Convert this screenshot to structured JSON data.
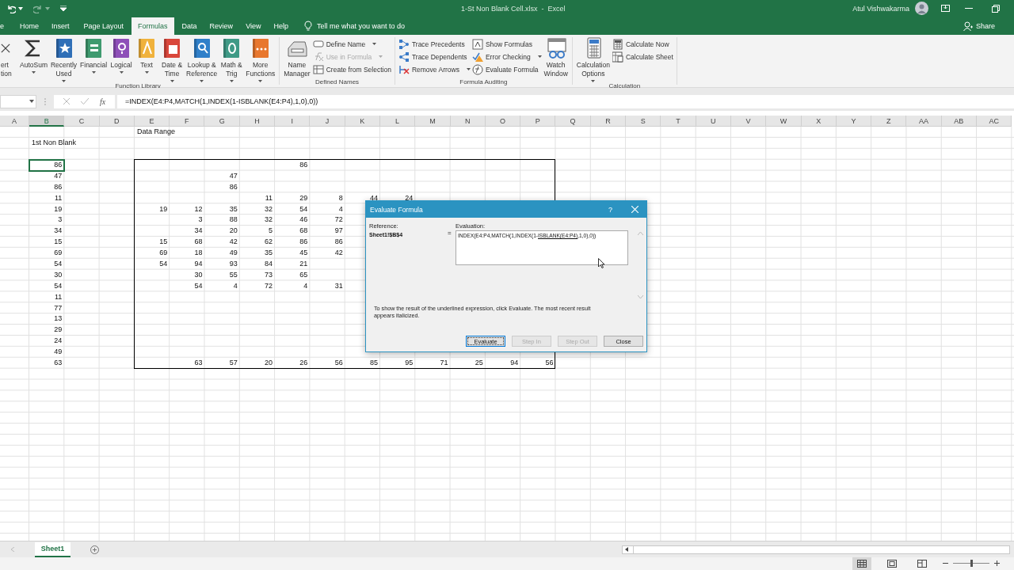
{
  "title_bar": {
    "document_title": "1-St Non Blank Cell.xlsx  -  Excel",
    "user_name": "Atul Vishwakarma"
  },
  "tabs": [
    {
      "label": "e",
      "selected": false
    },
    {
      "label": "Home",
      "selected": false
    },
    {
      "label": "Insert",
      "selected": false
    },
    {
      "label": "Page Layout",
      "selected": false
    },
    {
      "label": "Formulas",
      "selected": true
    },
    {
      "label": "Data",
      "selected": false
    },
    {
      "label": "Review",
      "selected": false
    },
    {
      "label": "View",
      "selected": false
    },
    {
      "label": "Help",
      "selected": false
    }
  ],
  "tell_me": "Tell me what you want to do",
  "share": "Share",
  "ribbon": {
    "groups": [
      {
        "label": "Function Library",
        "stacks": [
          [
            {
              "kind": "large",
              "lines": [
                "ert",
                "tion"
              ],
              "dropdown": false,
              "disabled": false
            }
          ],
          [
            {
              "kind": "large",
              "lines": [
                "AutoSum"
              ],
              "dropdown": true,
              "disabled": false
            }
          ],
          [
            {
              "kind": "large",
              "lines": [
                "Recently",
                "Used"
              ],
              "dropdown": true,
              "disabled": false
            }
          ],
          [
            {
              "kind": "large",
              "lines": [
                "Financial"
              ],
              "dropdown": true,
              "disabled": false
            }
          ],
          [
            {
              "kind": "large",
              "lines": [
                "Logical"
              ],
              "dropdown": true,
              "disabled": false
            }
          ],
          [
            {
              "kind": "large",
              "lines": [
                "Text"
              ],
              "dropdown": true,
              "disabled": false
            }
          ],
          [
            {
              "kind": "large",
              "lines": [
                "Date &",
                "Time"
              ],
              "dropdown": true,
              "disabled": false
            }
          ],
          [
            {
              "kind": "large",
              "lines": [
                "Lookup &",
                "Reference"
              ],
              "dropdown": true,
              "disabled": false
            }
          ],
          [
            {
              "kind": "large",
              "lines": [
                "Math &",
                "Trig"
              ],
              "dropdown": true,
              "disabled": false
            }
          ],
          [
            {
              "kind": "large",
              "lines": [
                "More",
                "Functions"
              ],
              "dropdown": true,
              "disabled": false
            }
          ]
        ]
      },
      {
        "label": "Defined Names",
        "stacks": [
          [
            {
              "kind": "large",
              "lines": [
                "Name",
                "Manager"
              ],
              "dropdown": false,
              "disabled": false
            }
          ],
          [
            {
              "kind": "small",
              "lines": [
                "Define Name"
              ],
              "dropdown": true,
              "disabled": false
            },
            {
              "kind": "small",
              "lines": [
                "Use in Formula"
              ],
              "dropdown": true,
              "disabled": true
            },
            {
              "kind": "small",
              "lines": [
                "Create from Selection"
              ],
              "dropdown": false,
              "disabled": false
            }
          ]
        ]
      },
      {
        "label": "Formula Auditing",
        "stacks": [
          [
            {
              "kind": "small",
              "lines": [
                "Trace Precedents"
              ],
              "dropdown": false,
              "disabled": false
            },
            {
              "kind": "small",
              "lines": [
                "Trace Dependents"
              ],
              "dropdown": false,
              "disabled": false
            },
            {
              "kind": "small",
              "lines": [
                "Remove Arrows"
              ],
              "dropdown": true,
              "disabled": false
            }
          ],
          [
            {
              "kind": "small",
              "lines": [
                "Show Formulas"
              ],
              "dropdown": false,
              "disabled": false
            },
            {
              "kind": "small",
              "lines": [
                "Error Checking"
              ],
              "dropdown": true,
              "disabled": false
            },
            {
              "kind": "small",
              "lines": [
                "Evaluate Formula"
              ],
              "dropdown": false,
              "disabled": false
            }
          ],
          [
            {
              "kind": "large",
              "lines": [
                "Watch",
                "Window"
              ],
              "dropdown": false,
              "disabled": false
            }
          ]
        ]
      },
      {
        "label": "Calculation",
        "stacks": [
          [
            {
              "kind": "large",
              "lines": [
                "Calculation",
                "Options"
              ],
              "dropdown": true,
              "disabled": false
            }
          ],
          [
            {
              "kind": "small",
              "lines": [
                "Calculate Now"
              ],
              "dropdown": false,
              "disabled": false
            },
            {
              "kind": "small",
              "lines": [
                "Calculate Sheet"
              ],
              "dropdown": false,
              "disabled": false
            }
          ]
        ]
      }
    ]
  },
  "formula_bar": {
    "fx_label": "fx",
    "formula": "=INDEX(E4:P4,MATCH(1,INDEX(1-ISBLANK(E4:P4),1,0),0))"
  },
  "sheet": {
    "columns": [
      {
        "label": "A",
        "selected": false
      },
      {
        "label": "B",
        "selected": true
      },
      {
        "label": "C",
        "selected": false
      },
      {
        "label": "D",
        "selected": false
      },
      {
        "label": "E",
        "selected": false
      },
      {
        "label": "F",
        "selected": false
      },
      {
        "label": "G",
        "selected": false
      },
      {
        "label": "H",
        "selected": false
      },
      {
        "label": "I",
        "selected": false
      },
      {
        "label": "J",
        "selected": false
      },
      {
        "label": "K",
        "selected": false
      },
      {
        "label": "L",
        "selected": false
      },
      {
        "label": "M",
        "selected": false
      },
      {
        "label": "N",
        "selected": false
      },
      {
        "label": "O",
        "selected": false
      },
      {
        "label": "P",
        "selected": false
      },
      {
        "label": "Q",
        "selected": false
      },
      {
        "label": "R",
        "selected": false
      },
      {
        "label": "S",
        "selected": false
      },
      {
        "label": "T",
        "selected": false
      },
      {
        "label": "U",
        "selected": false
      },
      {
        "label": "V",
        "selected": false
      },
      {
        "label": "W",
        "selected": false
      },
      {
        "label": "X",
        "selected": false
      },
      {
        "label": "Y",
        "selected": false
      },
      {
        "label": "Z",
        "selected": false
      },
      {
        "label": "AA",
        "selected": false
      },
      {
        "label": "AB",
        "selected": false
      },
      {
        "label": "AC",
        "selected": false
      }
    ],
    "rows": [
      {
        "kind": "label",
        "cells": [
          null,
          null,
          null,
          null,
          {
            "value": "Data Range",
            "selected": false
          }
        ]
      },
      {
        "kind": "label",
        "cells": [
          null,
          {
            "value": "1st Non Blank",
            "selected": false
          }
        ]
      },
      null,
      {
        "kind": "number",
        "cells": [
          null,
          {
            "value": "86",
            "selected": true
          },
          null,
          null,
          null,
          null,
          null,
          null,
          {
            "value": "86",
            "selected": false
          }
        ]
      },
      {
        "kind": "number",
        "cells": [
          null,
          {
            "value": "47",
            "selected": false
          },
          null,
          null,
          null,
          null,
          {
            "value": "47",
            "selected": false
          }
        ]
      },
      {
        "kind": "number",
        "cells": [
          null,
          {
            "value": "86",
            "selected": false
          },
          null,
          null,
          null,
          null,
          {
            "value": "86",
            "selected": false
          }
        ]
      },
      {
        "kind": "number",
        "cells": [
          null,
          {
            "value": "11",
            "selected": false
          },
          null,
          null,
          null,
          null,
          null,
          {
            "value": "11",
            "selected": false
          },
          {
            "value": "29",
            "selected": false
          },
          {
            "value": "8",
            "selected": false
          },
          {
            "value": "44",
            "selected": false
          },
          {
            "value": "24",
            "selected": false
          }
        ]
      },
      {
        "kind": "number",
        "cells": [
          null,
          {
            "value": "19",
            "selected": false
          },
          null,
          null,
          {
            "value": "19",
            "selected": false
          },
          {
            "value": "12",
            "selected": false
          },
          {
            "value": "35",
            "selected": false
          },
          {
            "value": "32",
            "selected": false
          },
          {
            "value": "54",
            "selected": false
          },
          {
            "value": "4",
            "selected": false
          }
        ]
      },
      {
        "kind": "number",
        "cells": [
          null,
          {
            "value": "3",
            "selected": false
          },
          null,
          null,
          null,
          {
            "value": "3",
            "selected": false
          },
          {
            "value": "88",
            "selected": false
          },
          {
            "value": "32",
            "selected": false
          },
          {
            "value": "46",
            "selected": false
          },
          {
            "value": "72",
            "selected": false
          }
        ]
      },
      {
        "kind": "number",
        "cells": [
          null,
          {
            "value": "34",
            "selected": false
          },
          null,
          null,
          null,
          {
            "value": "34",
            "selected": false
          },
          {
            "value": "20",
            "selected": false
          },
          {
            "value": "5",
            "selected": false
          },
          {
            "value": "68",
            "selected": false
          },
          {
            "value": "97",
            "selected": false
          }
        ]
      },
      {
        "kind": "number",
        "cells": [
          null,
          {
            "value": "15",
            "selected": false
          },
          null,
          null,
          {
            "value": "15",
            "selected": false
          },
          {
            "value": "68",
            "selected": false
          },
          {
            "value": "42",
            "selected": false
          },
          {
            "value": "62",
            "selected": false
          },
          {
            "value": "86",
            "selected": false
          },
          {
            "value": "86",
            "selected": false
          }
        ]
      },
      {
        "kind": "number",
        "cells": [
          null,
          {
            "value": "69",
            "selected": false
          },
          null,
          null,
          {
            "value": "69",
            "selected": false
          },
          {
            "value": "18",
            "selected": false
          },
          {
            "value": "49",
            "selected": false
          },
          {
            "value": "35",
            "selected": false
          },
          {
            "value": "45",
            "selected": false
          },
          {
            "value": "42",
            "selected": false
          }
        ]
      },
      {
        "kind": "number",
        "cells": [
          null,
          {
            "value": "54",
            "selected": false
          },
          null,
          null,
          {
            "value": "54",
            "selected": false
          },
          {
            "value": "94",
            "selected": false
          },
          {
            "value": "93",
            "selected": false
          },
          {
            "value": "84",
            "selected": false
          },
          {
            "value": "21",
            "selected": false
          }
        ]
      },
      {
        "kind": "number",
        "cells": [
          null,
          {
            "value": "30",
            "selected": false
          },
          null,
          null,
          null,
          {
            "value": "30",
            "selected": false
          },
          {
            "value": "55",
            "selected": false
          },
          {
            "value": "73",
            "selected": false
          },
          {
            "value": "65",
            "selected": false
          }
        ]
      },
      {
        "kind": "number",
        "cells": [
          null,
          {
            "value": "54",
            "selected": false
          },
          null,
          null,
          null,
          {
            "value": "54",
            "selected": false
          },
          {
            "value": "4",
            "selected": false
          },
          {
            "value": "72",
            "selected": false
          },
          {
            "value": "4",
            "selected": false
          },
          {
            "value": "31",
            "selected": false
          }
        ]
      },
      {
        "kind": "number",
        "cells": [
          null,
          {
            "value": "11",
            "selected": false
          }
        ]
      },
      {
        "kind": "number",
        "cells": [
          null,
          {
            "value": "77",
            "selected": false
          }
        ]
      },
      {
        "kind": "number",
        "cells": [
          null,
          {
            "value": "13",
            "selected": false
          }
        ]
      },
      {
        "kind": "number",
        "cells": [
          null,
          {
            "value": "29",
            "selected": false
          }
        ]
      },
      {
        "kind": "number",
        "cells": [
          null,
          {
            "value": "24",
            "selected": false
          }
        ]
      },
      {
        "kind": "number",
        "cells": [
          null,
          {
            "value": "49",
            "selected": false
          }
        ]
      },
      {
        "kind": "number",
        "cells": [
          null,
          {
            "value": "63",
            "selected": false
          },
          null,
          null,
          null,
          {
            "value": "63",
            "selected": false
          },
          {
            "value": "57",
            "selected": false
          },
          {
            "value": "20",
            "selected": false
          },
          {
            "value": "26",
            "selected": false
          },
          {
            "value": "56",
            "selected": false
          },
          {
            "value": "85",
            "selected": false
          },
          {
            "value": "95",
            "selected": false
          },
          {
            "value": "71",
            "selected": false
          },
          {
            "value": "25",
            "selected": false
          },
          {
            "value": "94",
            "selected": false
          },
          {
            "value": "56",
            "selected": false
          }
        ]
      }
    ]
  },
  "dialog": {
    "title": "Evaluate Formula",
    "help": "?",
    "reference_label": "Reference:",
    "reference": "Sheet1!$B$4",
    "equals": "=",
    "evaluation_label": "Evaluation:",
    "evaluation": {
      "before": "INDEX(E4:P4,MATCH(1,INDEX(1-",
      "underlined": "ISBLANK(E4:P4)",
      "after": ",1,0),0))"
    },
    "message": "To show the result of the underlined expression, click Evaluate.  The most recent result appears italicized.",
    "buttons": [
      {
        "label": "Evaluate",
        "disabled": false,
        "focused": true
      },
      {
        "label": "Step In",
        "disabled": true,
        "focused": false
      },
      {
        "label": "Step Out",
        "disabled": true,
        "focused": false
      },
      {
        "label": "Close",
        "disabled": false,
        "focused": false
      }
    ]
  },
  "sheet_tabs": [
    {
      "label": "Sheet1",
      "selected": true
    }
  ],
  "zoom": {
    "level": 0.5
  }
}
